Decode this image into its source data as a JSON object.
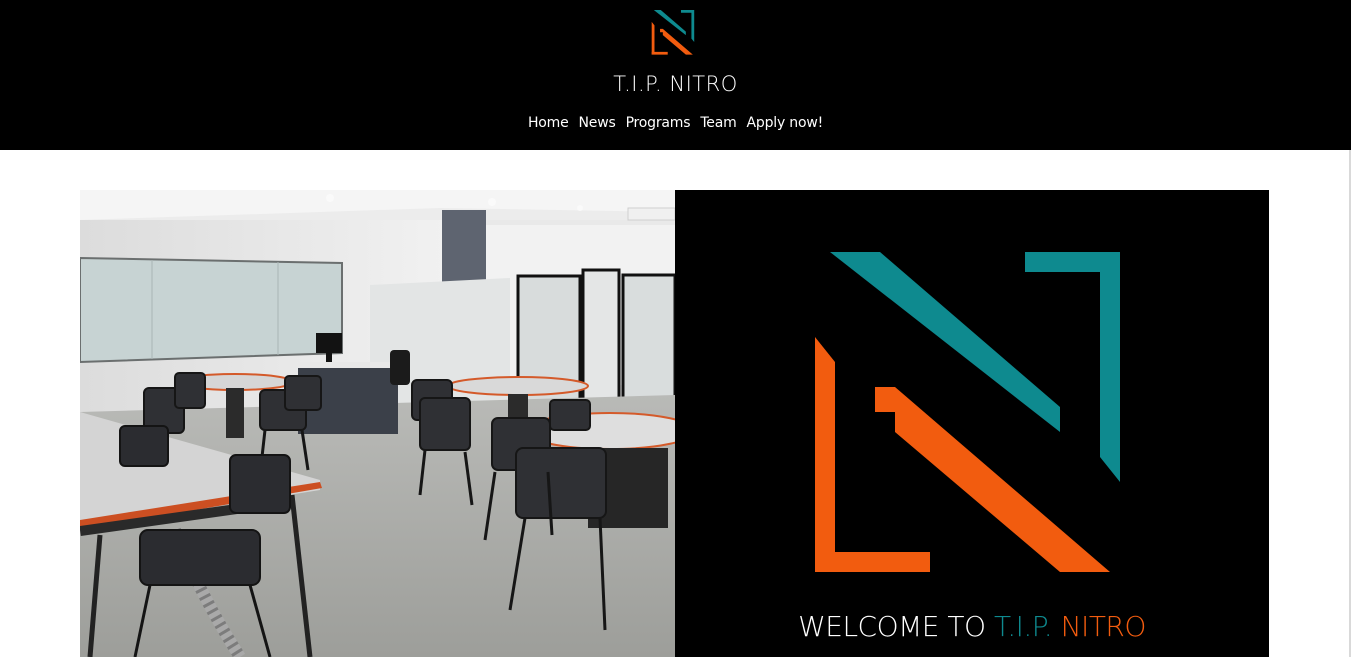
{
  "header": {
    "title": "T.I.P. NITRO",
    "nav": [
      {
        "label": "Home"
      },
      {
        "label": "News"
      },
      {
        "label": "Programs"
      },
      {
        "label": "Team"
      },
      {
        "label": "Apply now!"
      }
    ]
  },
  "hero": {
    "welcome_prefix": "WELCOME TO",
    "welcome_tip": "T.I.P.",
    "welcome_nitro": "NITRO"
  },
  "colors": {
    "teal": "#0e8a8f",
    "orange": "#f25c0f",
    "background_dark": "#000000"
  },
  "icons": {
    "brand_logo": "nitro-logo-icon"
  }
}
